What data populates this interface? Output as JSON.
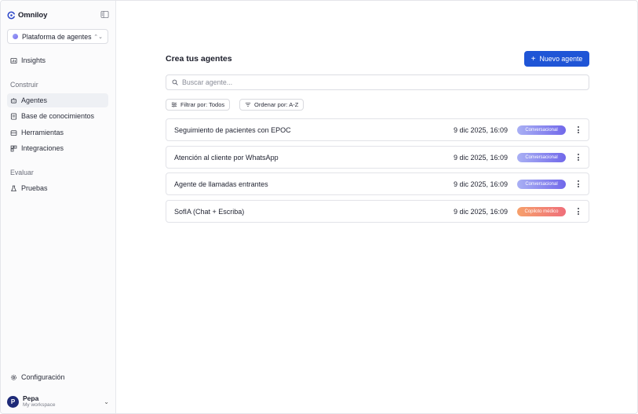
{
  "app": {
    "name": "Omniloy"
  },
  "platform_select": {
    "value": "Plataforma de agentes"
  },
  "sidebar": {
    "top_items": [
      {
        "label": "Insights",
        "icon": "chart-icon"
      }
    ],
    "sections": [
      {
        "label": "Construir",
        "items": [
          {
            "label": "Agentes",
            "icon": "bot-icon",
            "active": true
          },
          {
            "label": "Base de conocimientos",
            "icon": "book-icon"
          },
          {
            "label": "Herramientas",
            "icon": "toolbox-icon"
          },
          {
            "label": "Integraciones",
            "icon": "puzzle-icon"
          }
        ]
      },
      {
        "label": "Evaluar",
        "items": [
          {
            "label": "Pruebas",
            "icon": "flask-icon"
          }
        ]
      }
    ],
    "settings": {
      "label": "Configuración",
      "icon": "gear-icon"
    },
    "user": {
      "initial": "P",
      "name": "Pepa",
      "workspace": "My workspace"
    }
  },
  "main": {
    "title": "Crea tus agentes",
    "new_button": {
      "label": "Nuevo agente"
    },
    "search": {
      "placeholder": "Buscar agente..."
    },
    "filter": {
      "label": "Filtrar por: Todos"
    },
    "sort": {
      "label": "Ordenar por: A-Z"
    },
    "agents": [
      {
        "name": "Seguimiento de pacientes con EPOC",
        "date": "9 dic 2025, 16:09",
        "type": "Conversacional"
      },
      {
        "name": "Atención al cliente por WhatsApp",
        "date": "9 dic 2025, 16:09",
        "type": "Conversacional"
      },
      {
        "name": "Agente de llamadas entrantes",
        "date": "9 dic 2025, 16:09",
        "type": "Conversacional"
      },
      {
        "name": "SofIA (Chat + Escriba)",
        "date": "9 dic 2025, 16:09",
        "type": "Copiloto médico"
      }
    ]
  },
  "colors": {
    "primary": "#1f55d6",
    "conversational_badge": "#7168ea",
    "copilot_badge": "#ef6f7a",
    "avatar": "#1e2a78"
  }
}
